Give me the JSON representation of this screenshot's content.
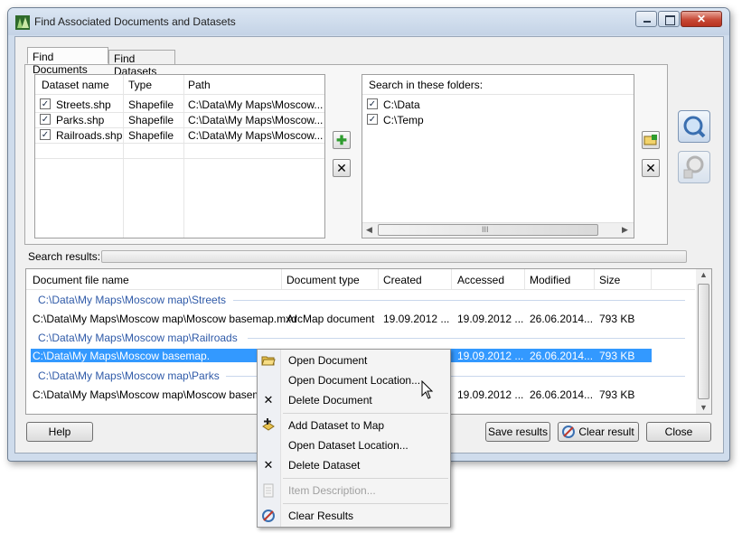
{
  "window": {
    "title": "Find Associated Documents and Datasets"
  },
  "tabs": [
    {
      "label": "Find Documents"
    },
    {
      "label": "Find Datasets"
    }
  ],
  "datasets": {
    "columns": [
      "Dataset name",
      "Type",
      "Path"
    ],
    "rows": [
      {
        "checked": true,
        "name": "Streets.shp",
        "type": "Shapefile",
        "path": "C:\\Data\\My Maps\\Moscow..."
      },
      {
        "checked": true,
        "name": "Parks.shp",
        "type": "Shapefile",
        "path": "C:\\Data\\My Maps\\Moscow..."
      },
      {
        "checked": true,
        "name": "Railroads.shp",
        "type": "Shapefile",
        "path": "C:\\Data\\My Maps\\Moscow..."
      }
    ]
  },
  "folders": {
    "header": "Search in these folders:",
    "rows": [
      {
        "checked": true,
        "path": "C:\\Data"
      },
      {
        "checked": true,
        "path": "C:\\Temp"
      }
    ],
    "scroll_grip": "III"
  },
  "search_results_label": "Search results:",
  "results": {
    "columns": [
      "Document file name",
      "Document type",
      "Created",
      "Accessed",
      "Modified",
      "Size"
    ],
    "groups": [
      {
        "title": "C:\\Data\\My Maps\\Moscow map\\Streets",
        "row": {
          "name": "C:\\Data\\My Maps\\Moscow map\\Moscow basemap.mxd",
          "type": "ArcMap document",
          "created": "19.09.2012 ...",
          "accessed": "19.09.2012 ...",
          "modified": "26.06.2014...",
          "size": "793 KB"
        }
      },
      {
        "title": "C:\\Data\\My Maps\\Moscow map\\Railroads",
        "row": {
          "name": "C:\\Data\\My Maps\\Moscow basemap.",
          "type": "",
          "created": "",
          "accessed": "19.09.2012 ...",
          "modified": "26.06.2014...",
          "size": "793 KB"
        }
      },
      {
        "title": "C:\\Data\\My Maps\\Moscow map\\Parks",
        "row": {
          "name": "C:\\Data\\My Maps\\Moscow map\\Moscow basemap.",
          "type": "",
          "created": "",
          "accessed": "19.09.2012 ...",
          "modified": "26.06.2014...",
          "size": "793 KB"
        }
      }
    ]
  },
  "buttons": {
    "help": "Help",
    "save": "Save results",
    "clear": "Clear result",
    "close": "Close"
  },
  "context_menu": {
    "items": [
      {
        "label": "Open Document",
        "enabled": true,
        "icon": "folder-open-icon"
      },
      {
        "label": "Open Document Location...",
        "enabled": true,
        "icon": ""
      },
      {
        "label": "Delete Document",
        "enabled": true,
        "icon": "x-icon"
      },
      {
        "label": "Add Dataset to Map",
        "enabled": true,
        "icon": "add-data-icon"
      },
      {
        "label": "Open Dataset Location...",
        "enabled": true,
        "icon": ""
      },
      {
        "label": "Delete Dataset",
        "enabled": true,
        "icon": "x-icon"
      },
      {
        "label": "Item Description...",
        "enabled": false,
        "icon": "description-icon"
      },
      {
        "label": "Clear Results",
        "enabled": true,
        "icon": "clear-results-icon"
      }
    ]
  },
  "colors": {
    "selection": "#3399ff",
    "group_title": "#2f5aa8",
    "accent": "#4a7fc0"
  }
}
